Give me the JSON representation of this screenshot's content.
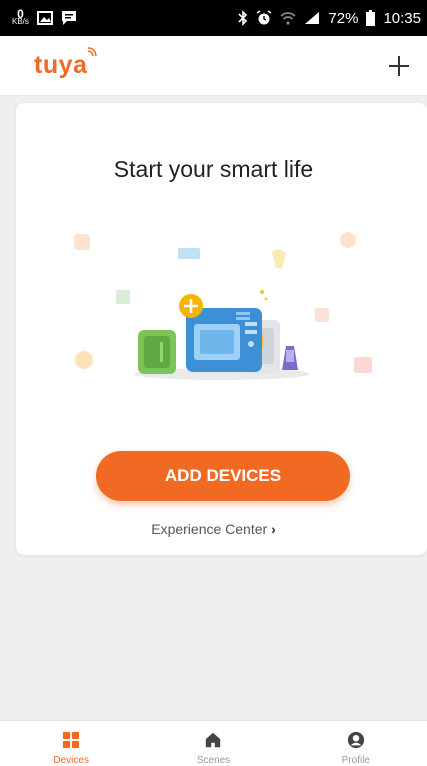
{
  "status_bar": {
    "data_speed_value": "0",
    "data_speed_unit": "KB/s",
    "battery": "72%",
    "time": "10:35"
  },
  "header": {
    "logo": "tuya"
  },
  "main": {
    "title": "Start your smart life",
    "add_devices_label": "ADD DEVICES",
    "experience_center_label": "Experience Center",
    "experience_center_chevron": "›"
  },
  "tabbar": {
    "tabs": [
      {
        "label": "Devices",
        "icon": "grid-icon",
        "active": true
      },
      {
        "label": "Scenes",
        "icon": "home-icon",
        "active": false
      },
      {
        "label": "Profile",
        "icon": "profile-icon",
        "active": false
      }
    ]
  },
  "colors": {
    "accent": "#f06a24",
    "status_bar_bg": "#000000",
    "page_bg": "#efefef"
  }
}
